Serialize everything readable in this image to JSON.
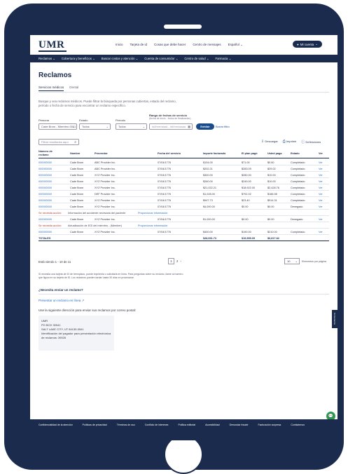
{
  "brand": {
    "logo": "UMR"
  },
  "top_links": [
    "Inicio",
    "Tarjeta de id",
    "Cosas que debe hacer",
    "Centro de mensajes",
    "Español"
  ],
  "account": {
    "label": "Mi cuenta"
  },
  "nav": [
    "Reclamos",
    "Cobertura y beneficios",
    "Buscar costos y atención",
    "Cuenta de consumidor",
    "Centro de salud",
    "Farmacia"
  ],
  "page": {
    "title": "Reclamos",
    "tabs": [
      "Servicios médicos",
      "Dental"
    ],
    "intro": "Busque y vea reclamos médicos. Puede filtrar la búsqueda por personas cubiertas, estado del reclamo, período o fecha de servicio para encontrar un reclamo específico."
  },
  "filters": {
    "persona_label": "Persona",
    "persona_value": "Cade Brom - Miembro 0001",
    "estado_label": "Estado",
    "estado_value": "Todos",
    "periodo_label": "Período",
    "periodo_value": "Todos",
    "fecha_label": "Rango de fechas de servicio",
    "fecha_hint": "(fecha de inicio - fecha de finalización)",
    "fecha_placeholder": "dd/mm/aaaa - dd/mm/aaaa",
    "apply_label": "Exhibir",
    "clear_label": "Borrar filtro"
  },
  "search": {
    "placeholder": "Filtrar resultados aquí"
  },
  "tools": {
    "download": "Descargar",
    "print": "Imprimir",
    "definitions": "Definiciones"
  },
  "table": {
    "headers": [
      "Número de reclamo",
      "Nombre",
      "Proveedor",
      "Fecha del servicio",
      "Importe facturado",
      "El plan pagó",
      "Usted paga",
      "Estado",
      "Ver"
    ],
    "rows": [
      [
        "000000000",
        "Cade Brom",
        "ABC Provider Inc.",
        "07/04/1776",
        "$104.00",
        "$71.00",
        "$0.60",
        "Completado",
        "Ver"
      ],
      [
        "000000000",
        "Cade Brom",
        "ABC Provider Inc.",
        "07/04/1776",
        "$202.21",
        "$283.09",
        "$29.02",
        "Completado",
        "Ver"
      ],
      [
        "000000000",
        "Cade Brom",
        "XYZ Provider Inc.",
        "07/04/1776",
        "$300.00",
        "$280.00",
        "$10.00",
        "Completado",
        "Ver"
      ],
      [
        "000000000",
        "Cade Brom",
        "XYZ Provider Inc.",
        "07/04/1776",
        "$260.00",
        "$249.00",
        "$10.00",
        "Completado",
        "Ver"
      ],
      [
        "000000000",
        "Cade Brom",
        "XYZ Provider Inc.",
        "07/04/1776",
        "$21,022.21",
        "$18,922.00",
        "$2,428.76",
        "Completado",
        "Ver"
      ],
      [
        "000000000",
        "Cade Brom",
        "DEF Provider Inc.",
        "07/04/1776",
        "$1,028.00",
        "$791.02",
        "$186.98",
        "Completado",
        "Ver"
      ],
      [
        "000000000",
        "Cade Brom",
        "XYZ Provider Inc.",
        "07/04/1776",
        "$947.73",
        "$23.40",
        "$914.31",
        "Completado",
        "Ver"
      ],
      [
        "000000000",
        "Cade Brom",
        "XYZ Provider Inc.",
        "07/04/1776",
        "$4,000.00",
        "$0.00",
        "$0.00",
        "Denegado",
        "Ver"
      ]
    ],
    "note1": {
      "tag": "Se necesita acción:",
      "text": "Información del accidente necesaria del paciente",
      "link": "Proporcionar información"
    },
    "row9": [
      "000000000",
      "Cade Brom",
      "XYZ Provider Inc.",
      "07/04/1776",
      "$1,000.00",
      "$0.00",
      "$0.00",
      "Denegado",
      "Ver"
    ],
    "note2": {
      "tag": "Se necesita acción:",
      "text": "Actualización de EOI del miembro - (Member)",
      "link": "Proporcionar información"
    },
    "row10": [
      "000000000",
      "Cade Brom",
      "XYZ Provider Inc.",
      "07/04/1776",
      "$400.00",
      "$190.00",
      "$210.00",
      "Completado",
      "Ver"
    ],
    "totals": [
      "TOTALES",
      "$28,931.73",
      "$19,959.09",
      "$6,817.82"
    ]
  },
  "pagination": {
    "summary": "Está viendo 1 - 10 de 11",
    "current": "1",
    "next": "2",
    "per_page": "10",
    "per_page_label": "Elementos por página"
  },
  "disclaimer": "Si necesita una tarjeta de ID de reemplazo, puede imprimirla o solicitarla en línea. Para preguntas sobre su reclamo, llame al número que figura en su tarjeta de ID. Los reclamos pueden tardar hasta 30 días en procesarse.",
  "lost_claim": {
    "heading": "¿Necesita enviar un reclamo?",
    "link": "Presentar un reclamo en línea",
    "mail_text": "Use la siguiente dirección para enviar sus reclamos por correo postal:",
    "address": [
      "UMR",
      "PO BOX 30541",
      "SALT LAKE CITY, UT 84130-0541",
      "Identificación del pagador para presentación electrónica de reclamos: 39026"
    ]
  },
  "side_tab": "Comentarios",
  "chat_icon": "chat-icon",
  "footer_links": [
    "Confidencialidad de la atención",
    "Políticas de privacidad",
    "Términos de uso",
    "Conflicto de intereses",
    "Política editorial",
    "Accesibilidad",
    "Denunciar fraude",
    "Facturación sorpresa",
    "Contáctenos"
  ],
  "colors": {
    "navy": "#1a2b4d",
    "link": "#2a6fc0",
    "accent": "#1a4c8c",
    "action": "#c0392b",
    "chat": "#2e9b4e"
  }
}
